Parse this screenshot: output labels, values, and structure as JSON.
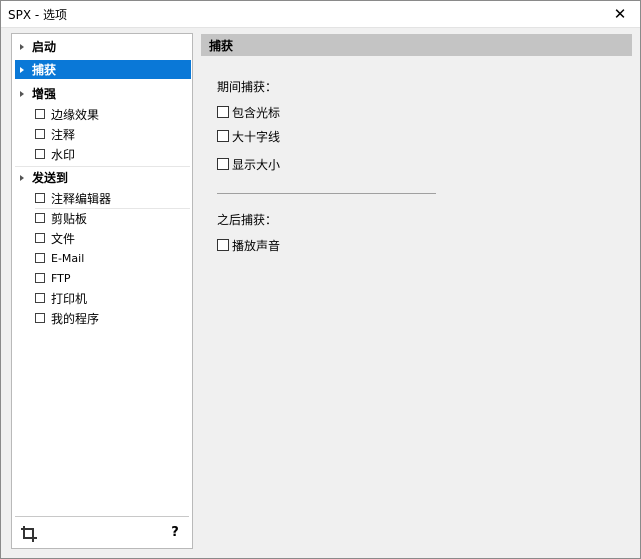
{
  "window": {
    "title": "SPX - 选项",
    "close_glyph": "✕"
  },
  "nav": {
    "categories": [
      {
        "label": "启动"
      },
      {
        "label": "捕获",
        "selected": true
      },
      {
        "label": "增强"
      },
      {
        "label": "发送到"
      }
    ],
    "enhance_items": [
      "边缘效果",
      "注释",
      "水印"
    ],
    "send_items": [
      "注释编辑器",
      "剪贴板",
      "文件",
      "E-Mail",
      "FTP",
      "打印机",
      "我的程序"
    ],
    "help_label": "?",
    "bottom_icon": "crop-icon"
  },
  "content": {
    "header": "捕获",
    "before_capture": {
      "label": "期间捕获：",
      "options": [
        "包含光标",
        "大十字线",
        "显示大小"
      ]
    },
    "after_capture": {
      "label": "之后捕获：",
      "options": [
        "播放声音"
      ]
    }
  },
  "colors": {
    "selected": "#0a78d7",
    "header_bg": "#c4c4c4",
    "window_bg": "#f0f0f0"
  }
}
